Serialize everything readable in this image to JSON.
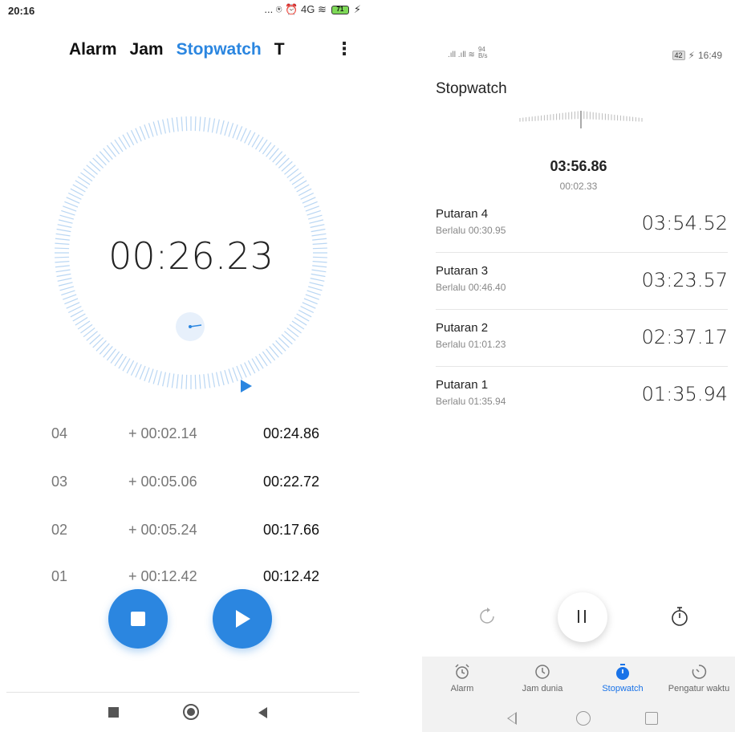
{
  "left": {
    "status_bar": {
      "time": "20:16",
      "icons": "... ⍟ ⏰ 4G ≋",
      "battery": "71"
    },
    "tabs": [
      {
        "label": "Alarm",
        "active": false
      },
      {
        "label": "Jam",
        "active": false
      },
      {
        "label": "Stopwatch",
        "active": true
      },
      {
        "label": "T",
        "active": false
      }
    ],
    "more_icon": "⋮",
    "elapsed": "00:26.23",
    "laps": [
      {
        "num": "04",
        "diff": "+ 00:02.14",
        "total": "00:24.86"
      },
      {
        "num": "03",
        "diff": "+ 00:05.06",
        "total": "00:22.72"
      },
      {
        "num": "02",
        "diff": "+ 00:05.24",
        "total": "00:17.66"
      },
      {
        "num": "01",
        "diff": "+ 00:12.42",
        "total": "00:12.42"
      }
    ],
    "controls": {
      "stop_icon": "stop-icon",
      "resume_icon": "play-icon"
    },
    "accent": "#2b86e0"
  },
  "right": {
    "status_bar": {
      "signal": ".ıll .ıll ≋",
      "speed_top": "94",
      "speed_bottom": "B/s",
      "battery": "42",
      "time": "16:49"
    },
    "title": "Stopwatch",
    "total": "03:56.86",
    "current_lap": "00:02.33",
    "laps": [
      {
        "name": "Putaran 4",
        "elapsed": "Berlalu 00:30.95",
        "time": "03:54.52"
      },
      {
        "name": "Putaran 3",
        "elapsed": "Berlalu 00:46.40",
        "time": "03:23.57"
      },
      {
        "name": "Putaran 2",
        "elapsed": "Berlalu 01:01.23",
        "time": "02:37.17"
      },
      {
        "name": "Putaran 1",
        "elapsed": "Berlalu 01:35.94",
        "time": "01:35.94"
      }
    ],
    "bottom_tabs": [
      {
        "label": "Alarm",
        "icon": "alarm-clock-icon",
        "active": false
      },
      {
        "label": "Jam dunia",
        "icon": "clock-icon",
        "active": false
      },
      {
        "label": "Stopwatch",
        "icon": "stopwatch-icon",
        "active": true
      },
      {
        "label": "Pengatur waktu",
        "icon": "timer-icon",
        "active": false
      }
    ],
    "accent": "#1a73e8"
  }
}
